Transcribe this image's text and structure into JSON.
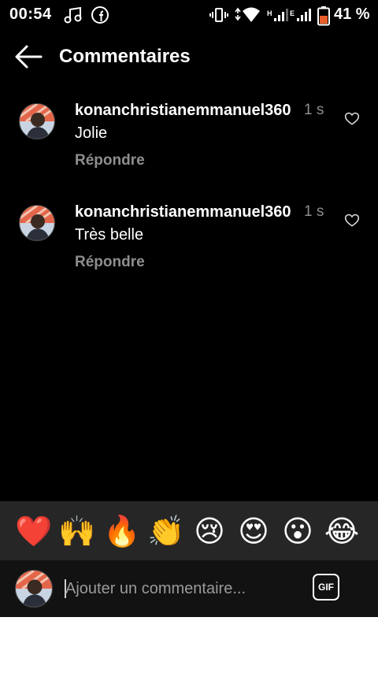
{
  "status_bar": {
    "time": "00:54",
    "battery_percent": "41 %",
    "network_h": "H",
    "network_e": "E",
    "icons": [
      "music-note-icon",
      "facebook-icon",
      "vibrate-icon",
      "wifi-icon",
      "signal-icon",
      "signal-icon",
      "battery-icon"
    ]
  },
  "header": {
    "back_icon": "arrow-left-icon",
    "title": "Commentaires"
  },
  "comments": [
    {
      "username": "konanchristianemmanuel360",
      "time": "1 s",
      "text": "Jolie",
      "reply_label": "Répondre"
    },
    {
      "username": "konanchristianemmanuel360",
      "time": "1 s",
      "text": "Très belle",
      "reply_label": "Répondre"
    }
  ],
  "emoji_bar": {
    "emojis": [
      "❤️",
      "🙌",
      "🔥",
      "👏",
      "😢",
      "😍",
      "😮",
      "😂"
    ]
  },
  "input_bar": {
    "placeholder": "Ajouter un commentaire...",
    "gif_label": "GIF"
  },
  "colors": {
    "background": "#000000",
    "secondary_text": "#8e8e8e",
    "emoji_bar_bg": "#262626"
  }
}
